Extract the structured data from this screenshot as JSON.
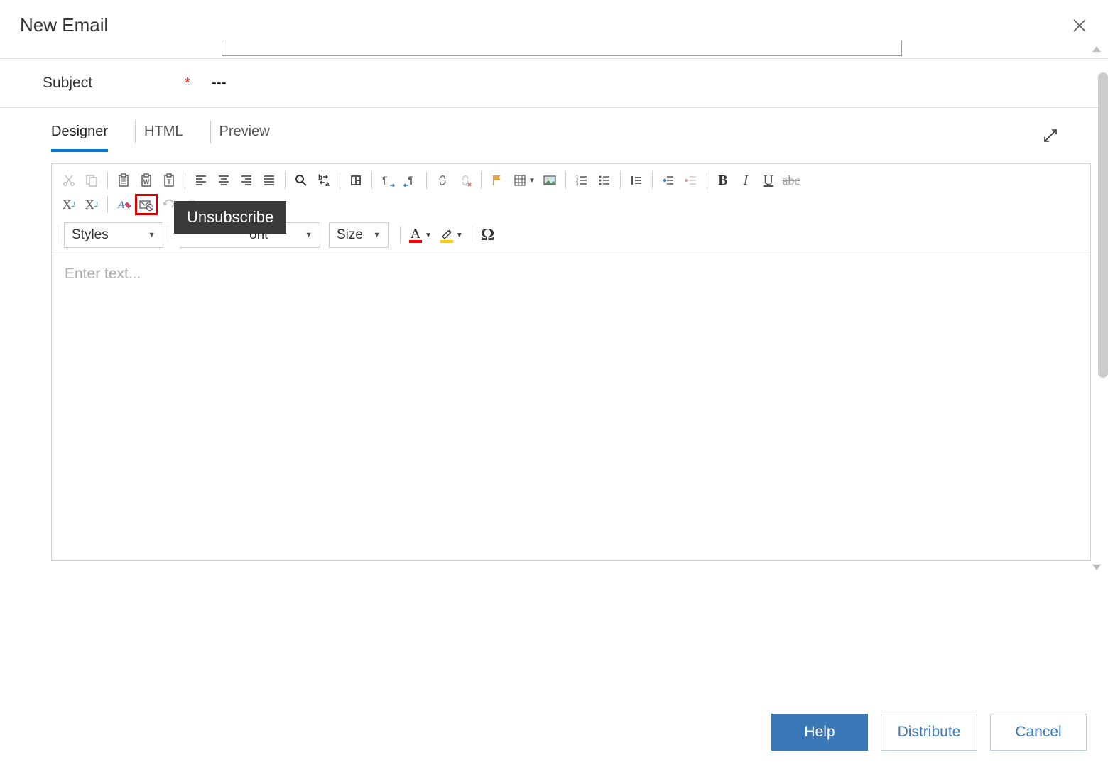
{
  "header": {
    "title": "New Email"
  },
  "subject": {
    "label": "Subject",
    "value": "---"
  },
  "tabs": {
    "designer": "Designer",
    "html": "HTML",
    "preview": "Preview"
  },
  "tooltip": {
    "unsubscribe": "Unsubscribe"
  },
  "combos": {
    "styles": "Styles",
    "font_partial": "ont",
    "size": "Size"
  },
  "editor": {
    "placeholder": "Enter text..."
  },
  "footer": {
    "help": "Help",
    "distribute": "Distribute",
    "cancel": "Cancel"
  },
  "icons": {
    "cut": "cut",
    "copy": "copy",
    "paste": "paste",
    "paste_word": "paste-word",
    "paste_text": "paste-text",
    "align_left": "align-left",
    "align_center": "align-center",
    "align_right": "align-right",
    "justify": "justify",
    "find": "find",
    "replace": "replace",
    "templates": "templates",
    "ltr": "ltr",
    "rtl": "rtl",
    "link": "link",
    "unlink": "unlink",
    "flag": "flag",
    "table": "table",
    "image": "image",
    "num_list": "num-list",
    "bul_list": "bul-list",
    "quote": "blockquote",
    "indent": "indent",
    "outdent": "outdent",
    "bold": "B",
    "italic": "I",
    "underline": "U",
    "strike": "abc",
    "sub": "X",
    "sup": "X",
    "clear_format": "clear-format",
    "unsubscribe": "unsubscribe",
    "undo": "undo",
    "redo": "redo",
    "font_color_glyph": "A",
    "omega": "Ω"
  }
}
